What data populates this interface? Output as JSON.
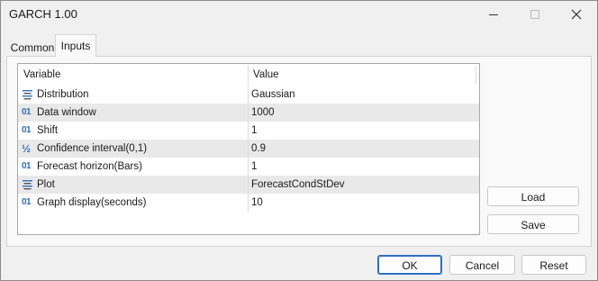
{
  "window": {
    "title": "GARCH 1.00"
  },
  "tabs": [
    {
      "label": "Common",
      "active": false
    },
    {
      "label": "Inputs",
      "active": true
    }
  ],
  "table": {
    "headers": {
      "variable": "Variable",
      "value": "Value"
    },
    "rows": [
      {
        "icon": "list-enum-icon",
        "variable": "Distribution",
        "value": "Gaussian"
      },
      {
        "icon": "integer-icon",
        "variable": "Data window",
        "value": "1000"
      },
      {
        "icon": "integer-icon",
        "variable": "Shift",
        "value": "1"
      },
      {
        "icon": "fraction-icon",
        "variable": "Confidence interval(0,1)",
        "value": "0.9"
      },
      {
        "icon": "integer-icon",
        "variable": "Forecast horizon(Bars)",
        "value": "1"
      },
      {
        "icon": "list-enum-icon",
        "variable": "Plot",
        "value": "ForecastCondStDev"
      },
      {
        "icon": "integer-icon",
        "variable": "Graph display(seconds)",
        "value": "10"
      }
    ]
  },
  "side_buttons": {
    "load": "Load",
    "save": "Save"
  },
  "footer_buttons": {
    "ok": "OK",
    "cancel": "Cancel",
    "reset": "Reset"
  },
  "icon_glyphs": {
    "integer": "01",
    "fraction": "½"
  },
  "colors": {
    "accent": "#2f6fc1",
    "alt_row": "#e9e9e9",
    "dialog_bg": "#f0f0f0"
  }
}
